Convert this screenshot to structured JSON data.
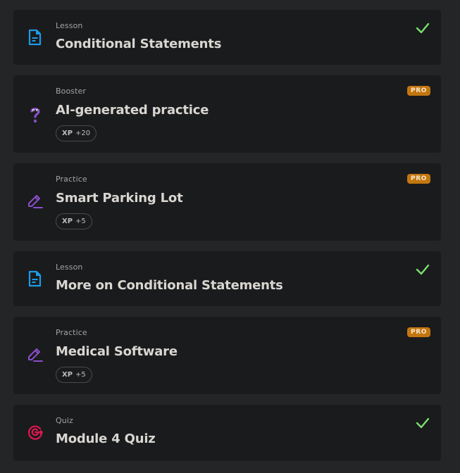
{
  "colors": {
    "background": "#242527",
    "card": "#1a1b1d",
    "lesson_icon": "#1d9be8",
    "booster_icon": "#8a4ec9",
    "practice_icon": "#8a4ec9",
    "quiz_icon": "#e0174f",
    "check": "#7ae06e",
    "pro_badge": "#c3760f"
  },
  "items": [
    {
      "kind": "Lesson",
      "title": "Conditional Statements",
      "icon": "document-icon",
      "completed": true
    },
    {
      "kind": "Booster",
      "title": "AI-generated practice",
      "icon": "question-icon",
      "pro_label": "PRO",
      "xp_label": "XP",
      "xp_value": "+20"
    },
    {
      "kind": "Practice",
      "title": "Smart Parking Lot",
      "icon": "pencil-icon",
      "pro_label": "PRO",
      "xp_label": "XP",
      "xp_value": "+5"
    },
    {
      "kind": "Lesson",
      "title": "More on Conditional Statements",
      "icon": "document-icon",
      "completed": true
    },
    {
      "kind": "Practice",
      "title": "Medical Software",
      "icon": "pencil-icon",
      "pro_label": "PRO",
      "xp_label": "XP",
      "xp_value": "+5"
    },
    {
      "kind": "Quiz",
      "title": "Module 4 Quiz",
      "icon": "target-icon",
      "completed": true
    }
  ]
}
